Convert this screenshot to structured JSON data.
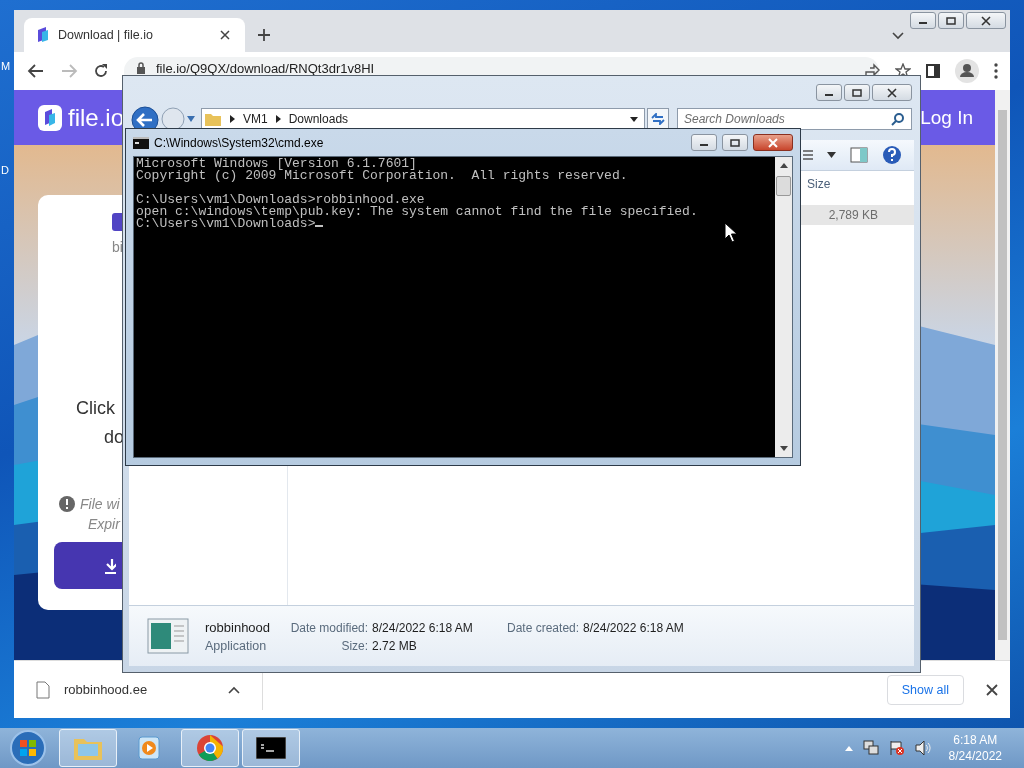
{
  "desktop": {
    "icon_labels": [
      "M",
      "D"
    ]
  },
  "browser": {
    "tabs": [
      {
        "title": "Download | file.io",
        "selected": true
      }
    ],
    "address": "file.io/Q9QX/download/RNQt3dr1v8HI",
    "page": {
      "logo": "file.io",
      "login": "Log In",
      "card": {
        "name_partial": "bi",
        "prompt": [
          "Click",
          "do"
        ],
        "notice": [
          "File wi",
          "Expir"
        ]
      }
    },
    "download_bar": {
      "file": "robbinhood.ee",
      "show_all": "Show all"
    }
  },
  "explorer": {
    "breadcrumb": [
      "VM1",
      "Downloads"
    ],
    "search": {
      "placeholder": "Search Downloads"
    },
    "columns": [
      "Size"
    ],
    "rows": [
      {
        "size": "2,789 KB",
        "selected": true
      }
    ],
    "details": {
      "name": "robbinhood",
      "type": "Application",
      "fields": [
        {
          "label": "Date modified:",
          "value": "8/24/2022 6:18 AM"
        },
        {
          "label": "Date created:",
          "value": "8/24/2022 6:18 AM"
        },
        {
          "label": "Size:",
          "value": "2.72 MB"
        }
      ]
    }
  },
  "cmd": {
    "title": "C:\\Windows\\System32\\cmd.exe",
    "banner": [
      "Microsoft Windows [Version 6.1.7601]",
      "Copyright (c) 2009 Microsoft Corporation.  All rights reserved."
    ],
    "session": [
      "C:\\Users\\vm1\\Downloads>robbinhood.exe",
      "open c:\\windows\\temp\\pub.key: The system cannot find the file specified.",
      "C:\\Users\\vm1\\Downloads>"
    ]
  },
  "taskbar": {
    "apps": [
      {
        "kind": "explorer",
        "running": true
      },
      {
        "kind": "media",
        "running": false
      },
      {
        "kind": "chrome",
        "running": true
      },
      {
        "kind": "cmd",
        "running": true
      }
    ],
    "time": "6:18 AM",
    "date": "8/24/2022"
  }
}
